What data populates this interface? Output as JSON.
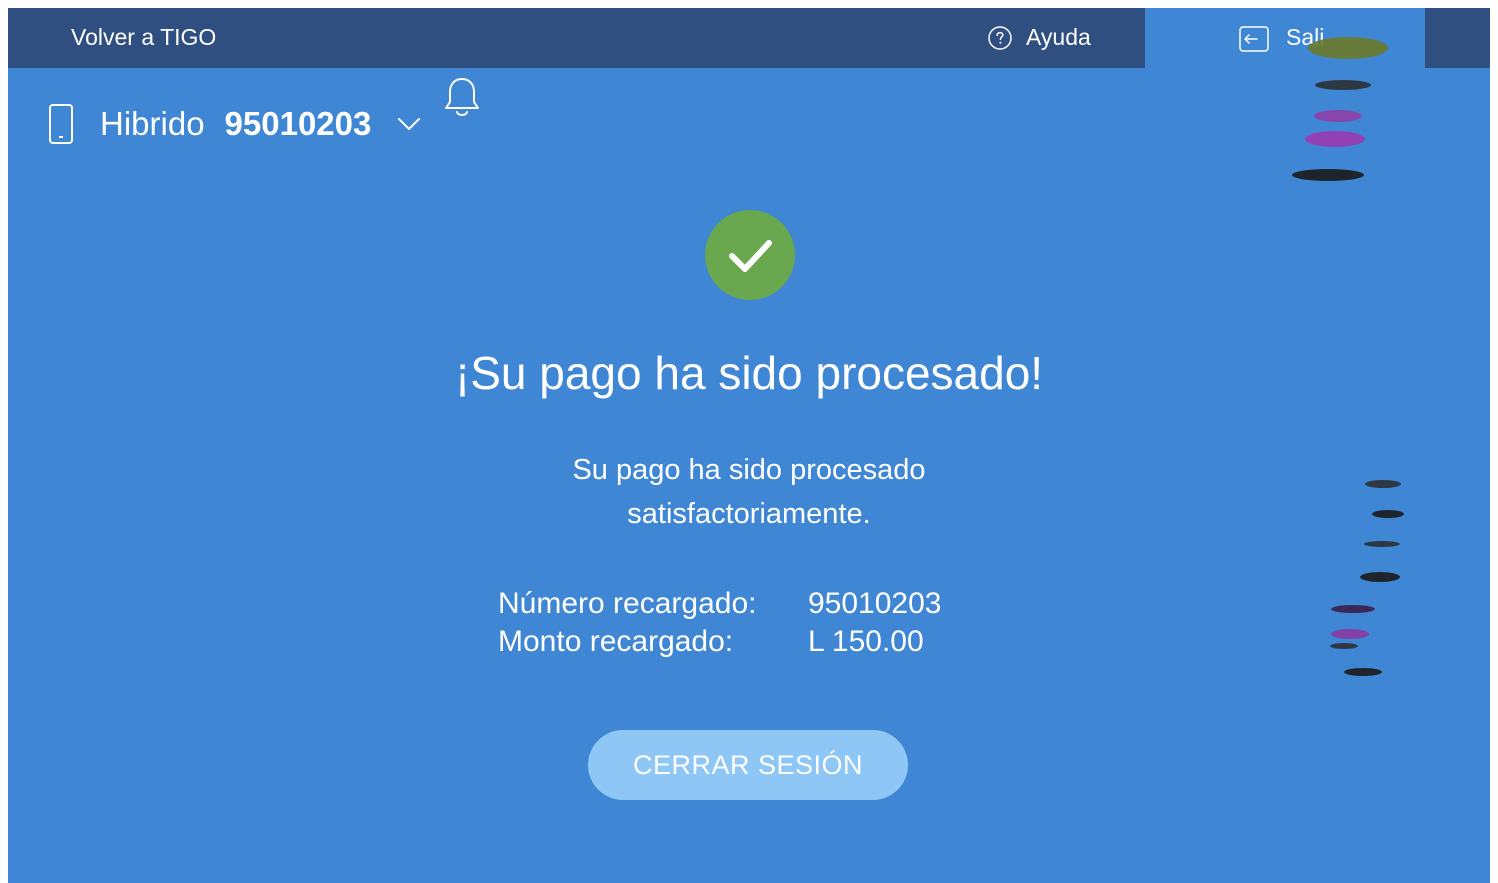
{
  "header": {
    "back_label": "Volver a TIGO",
    "help_label": "Ayuda",
    "logout_label": "Sali"
  },
  "account": {
    "line_type": "Hibrido",
    "line_number": "95010203"
  },
  "result": {
    "title": "¡Su pago ha sido procesado!",
    "subtitle": "Su pago ha sido procesado satisfactoriamente.",
    "details": [
      {
        "label": "Número recargado:",
        "value": "95010203"
      },
      {
        "label": "Monto recargado:",
        "value": "L 150.00"
      }
    ]
  },
  "actions": {
    "close_session_label": "CERRAR SESIÓN"
  },
  "colors": {
    "background": "#3f86d4",
    "topbar": "#2f4f80",
    "success": "#6aa84f",
    "button": "#8ec6f5"
  },
  "icons": {
    "help": "question-circle-icon",
    "logout": "logout-arrow-icon",
    "phone": "mobile-phone-icon",
    "notifications": "bell-icon",
    "dropdown": "chevron-down-icon",
    "success": "checkmark-icon"
  }
}
